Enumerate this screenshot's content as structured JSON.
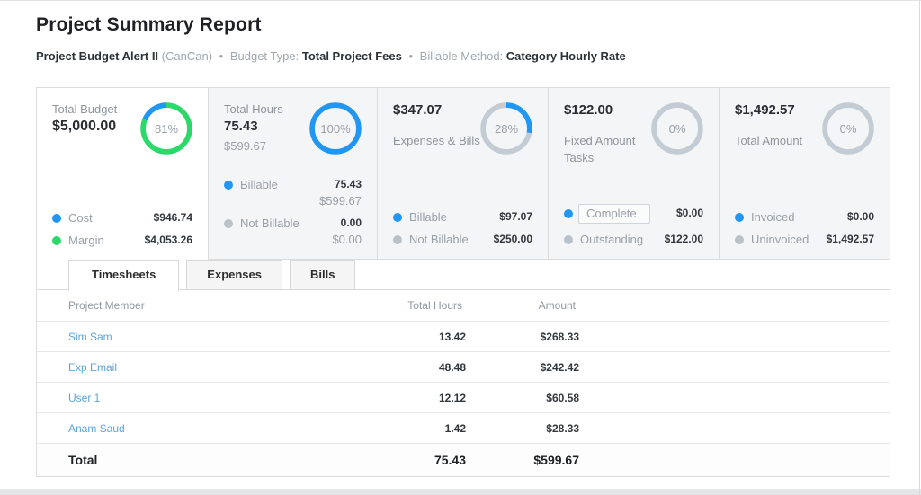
{
  "page": {
    "title": "Project Summary Report"
  },
  "subtitle": {
    "project": "Project Budget Alert II",
    "client": "(CanCan)",
    "sep": "•",
    "budget_type_label": "Budget Type:",
    "budget_type_value": "Total Project Fees",
    "billable_method_label": "Billable Method:",
    "billable_method_value": "Category Hourly Rate"
  },
  "colors": {
    "blue": "#2196f3",
    "green": "#2bd96a",
    "gray_ring": "#c3ccd4",
    "gray_dot": "#b9c1c9"
  },
  "cards": [
    {
      "title": "Total Budget",
      "amount": "$5,000.00",
      "donut": {
        "label": "81%",
        "segments": [
          {
            "color": "#2bd96a",
            "pct": 81
          },
          {
            "color": "#2196f3",
            "pct": 19
          }
        ]
      },
      "legend": [
        {
          "dot": "#2196f3",
          "label": "Cost",
          "value": "$946.74"
        },
        {
          "dot": "#2bd96a",
          "label": "Margin",
          "value": "$4,053.26"
        }
      ]
    },
    {
      "title": "Total Hours",
      "amount": "75.43",
      "sub": "$599.67",
      "donut": {
        "label": "100%",
        "segments": [
          {
            "color": "#2196f3",
            "pct": 100
          }
        ]
      },
      "legend": [
        {
          "dot": "#2196f3",
          "label": "Billable",
          "value": "75.43",
          "sub": "$599.67"
        },
        {
          "dot": "#b9c1c9",
          "label": "Not Billable",
          "value": "0.00",
          "sub": "$0.00"
        }
      ]
    },
    {
      "amount": "$347.07",
      "title2": "Expenses & Bills",
      "donut": {
        "label": "28%",
        "segments": [
          {
            "color": "#2196f3",
            "pct": 28
          },
          {
            "color": "#c3ccd4",
            "pct": 72
          }
        ]
      },
      "legend": [
        {
          "dot": "#2196f3",
          "label": "Billable",
          "value": "$97.07"
        },
        {
          "dot": "#b9c1c9",
          "label": "Not Billable",
          "value": "$250.00"
        }
      ]
    },
    {
      "amount": "$122.00",
      "title2": "Fixed Amount Tasks",
      "donut": {
        "label": "0%",
        "segments": [
          {
            "color": "#c3ccd4",
            "pct": 100
          }
        ]
      },
      "legend": [
        {
          "dot": "#2196f3",
          "label": "Complete",
          "value": "$0.00",
          "boxed": true
        },
        {
          "dot": "#b9c1c9",
          "label": "Outstanding",
          "value": "$122.00"
        }
      ]
    },
    {
      "amount": "$1,492.57",
      "title2": "Total Amount",
      "donut": {
        "label": "0%",
        "segments": [
          {
            "color": "#c3ccd4",
            "pct": 100
          }
        ]
      },
      "legend": [
        {
          "dot": "#2196f3",
          "label": "Invoiced",
          "value": "$0.00"
        },
        {
          "dot": "#b9c1c9",
          "label": "Uninvoiced",
          "value": "$1,492.57"
        }
      ]
    }
  ],
  "tabs": [
    {
      "label": "Timesheets",
      "active": true
    },
    {
      "label": "Expenses",
      "active": false
    },
    {
      "label": "Bills",
      "active": false
    }
  ],
  "table": {
    "headers": {
      "member": "Project Member",
      "hours": "Total Hours",
      "amount": "Amount"
    },
    "rows": [
      {
        "member": "Sim Sam",
        "hours": "13.42",
        "amount": "$268.33"
      },
      {
        "member": "Exp Email",
        "hours": "48.48",
        "amount": "$242.42"
      },
      {
        "member": "User 1",
        "hours": "12.12",
        "amount": "$60.58"
      },
      {
        "member": "Anam Saud",
        "hours": "1.42",
        "amount": "$28.33"
      }
    ],
    "total": {
      "label": "Total",
      "hours": "75.43",
      "amount": "$599.67"
    }
  }
}
